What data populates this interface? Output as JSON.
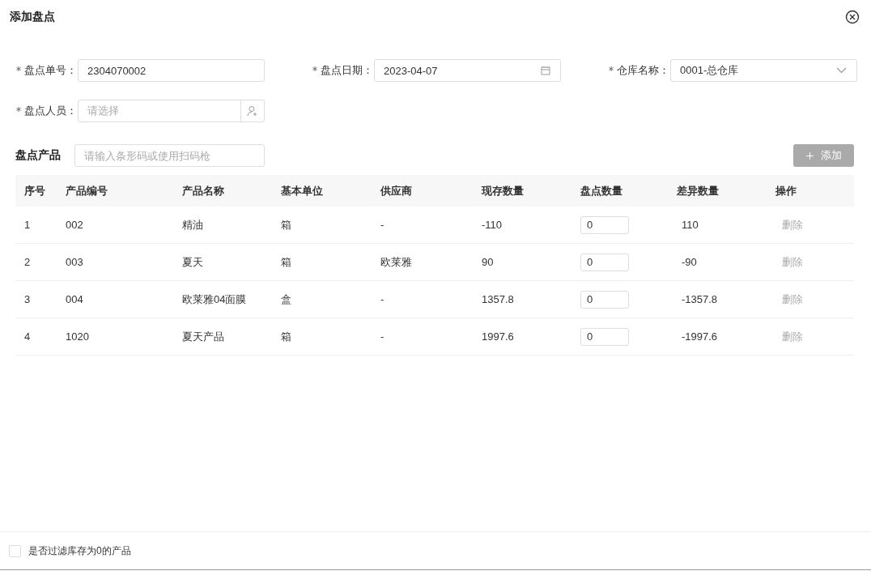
{
  "dialog": {
    "title": "添加盘点"
  },
  "form_fields": [
    {
      "kind": "text",
      "required": true,
      "label": "盘点单号：",
      "value": "2304070002"
    },
    {
      "kind": "date",
      "required": true,
      "label": "盘点日期：",
      "value": "2023-04-07"
    },
    {
      "kind": "select",
      "required": true,
      "label": "仓库名称：",
      "value": "0001-总仓库"
    },
    {
      "kind": "picker",
      "required": true,
      "label": "盘点人员：",
      "placeholder": "请选择"
    }
  ],
  "products": {
    "title": "盘点产品",
    "scan_field": {
      "placeholder": "请输入条形码或使用扫码枪"
    },
    "add_button": "添加",
    "table": {
      "columns": [
        "序号",
        "产品编号",
        "产品名称",
        "基本单位",
        "供应商",
        "现存数量",
        "盘点数量",
        "差异数量",
        "操作"
      ],
      "rows": [
        {
          "index": "1",
          "code": "002",
          "name": "精油",
          "unit": "箱",
          "supplier": "-",
          "stock": "-110",
          "count": "0",
          "diff": "110",
          "action": "删除"
        },
        {
          "index": "2",
          "code": "003",
          "name": "夏天",
          "unit": "箱",
          "supplier": "欧莱雅",
          "stock": "90",
          "count": "0",
          "diff": "-90",
          "action": "删除"
        },
        {
          "index": "3",
          "code": "004",
          "name": "欧莱雅04面膜",
          "unit": "盒",
          "supplier": "-",
          "stock": "1357.8",
          "count": "0",
          "diff": "-1357.8",
          "action": "删除"
        },
        {
          "index": "4",
          "code": "1020",
          "name": "夏天产品",
          "unit": "箱",
          "supplier": "-",
          "stock": "1997.6",
          "count": "0",
          "diff": "-1997.6",
          "action": "删除"
        }
      ]
    }
  },
  "footer": {
    "filter_checkbox": {
      "label": "是否过滤库存为0的产品",
      "checked": false
    }
  }
}
